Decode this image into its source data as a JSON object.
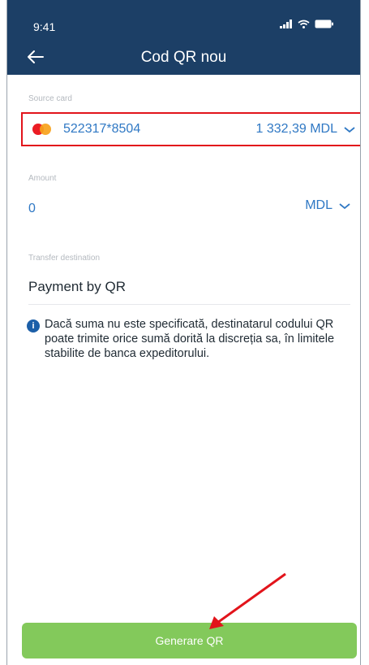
{
  "status_bar": {
    "time": "9:41"
  },
  "header": {
    "title": "Cod QR nou"
  },
  "source_card": {
    "label": "Source card",
    "card_number": "522317*8504",
    "balance": "1 332,39 MDL"
  },
  "amount": {
    "label": "Amount",
    "value": "0",
    "currency": "MDL"
  },
  "transfer_destination": {
    "label": "Transfer destination",
    "value": "Payment by QR"
  },
  "info": {
    "icon": "info-icon",
    "text": "Dacă suma nu este specificată, destinatarul codului QR poate trimite  orice sumă dorită la discreția sa, în limitele stabilite de banca expeditorului."
  },
  "footer": {
    "generate_label": "Generare QR"
  },
  "colors": {
    "header_bg": "#1c3f66",
    "accent_blue": "#2f78c4",
    "highlight_red": "#e2141b",
    "button_green": "#83c95b"
  }
}
